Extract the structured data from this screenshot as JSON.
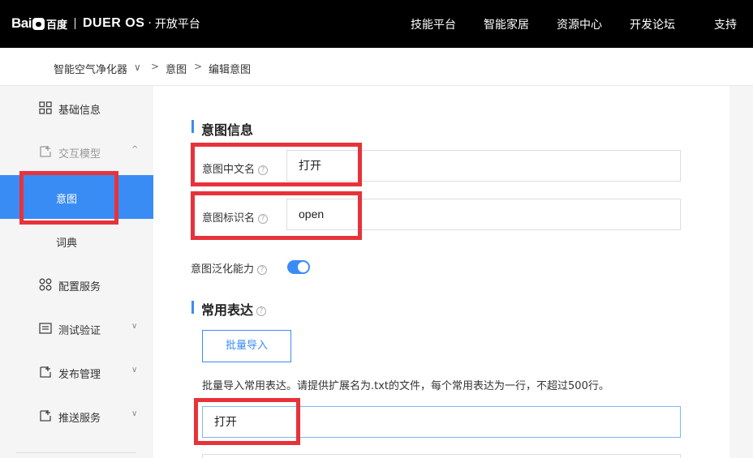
{
  "header": {
    "logo_bai": "Bai",
    "logo_du": "百度",
    "logo_dueros": "DUER OS",
    "logo_dot": "·",
    "logo_platform": "开放平台",
    "nav": [
      "技能平台",
      "智能家居",
      "资源中心",
      "开发论坛",
      "支持"
    ]
  },
  "breadcrumb": {
    "skill": "智能空气净化器",
    "skill_caret": "∨",
    "sep": ">",
    "intent": "意图",
    "current": "编辑意图"
  },
  "sidebar": {
    "items": [
      {
        "label": "基础信息",
        "icon": "grid-icon"
      },
      {
        "label": "交互模型",
        "icon": "add-doc-icon",
        "caret": "^"
      },
      {
        "label": "意图"
      },
      {
        "label": "词典"
      },
      {
        "label": "配置服务",
        "icon": "service-icon"
      },
      {
        "label": "测试验证",
        "icon": "test-icon",
        "caret": "∨"
      },
      {
        "label": "发布管理",
        "icon": "publish-icon",
        "caret": "∨"
      },
      {
        "label": "推送服务",
        "icon": "push-icon",
        "caret": "∨"
      }
    ]
  },
  "intent_info": {
    "title": "意图信息",
    "cn_name_label": "意图中文名",
    "cn_name_value": "打开",
    "id_label": "意图标识名",
    "id_value": "open",
    "generalize_label": "意图泛化能力",
    "help": "?"
  },
  "expressions": {
    "title": "常用表达",
    "import_button": "批量导入",
    "hint": "批量导入常用表达。请提供扩展名为.txt的文件，每个常用表达为一行，不超过500行。",
    "first_value": "打开"
  },
  "colors": {
    "accent": "#3a8cf5",
    "highlight": "#e8323a"
  }
}
